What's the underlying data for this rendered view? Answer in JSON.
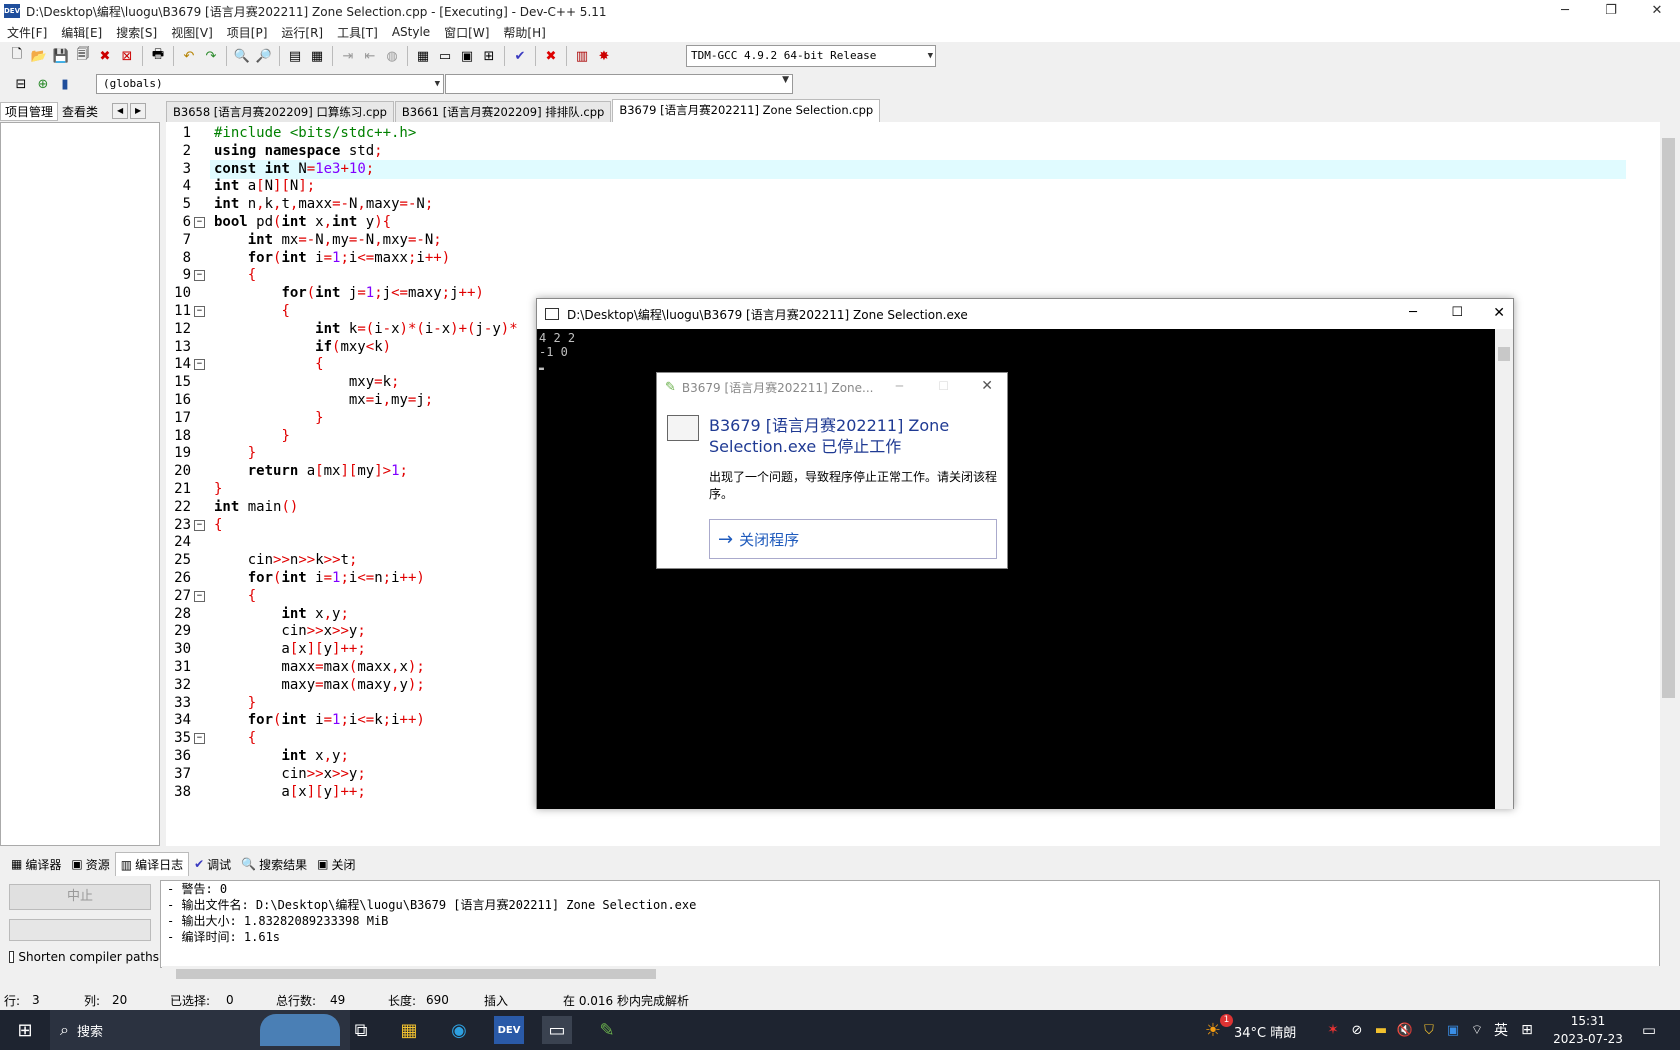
{
  "window": {
    "title": "D:\\Desktop\\编程\\luogu\\B3679 [语言月赛202211] Zone Selection.cpp - [Executing] - Dev-C++ 5.11",
    "app_icon_text": "DEV",
    "min": "─",
    "max": "❐",
    "close": "✕"
  },
  "menu": [
    "文件[F]",
    "编辑[E]",
    "搜索[S]",
    "视图[V]",
    "项目[P]",
    "运行[R]",
    "工具[T]",
    "AStyle",
    "窗口[W]",
    "帮助[H]"
  ],
  "compiler_select": "TDM-GCC 4.9.2 64-bit Release",
  "scope_select": "(globals)",
  "left_tabs": [
    "项目管理",
    "查看类"
  ],
  "left_tab_arrows": [
    "◀",
    "▶"
  ],
  "file_tabs": [
    "B3658 [语言月赛202209] 口算练习.cpp",
    "B3661 [语言月赛202209] 排排队.cpp",
    "B3679 [语言月赛202211] Zone Selection.cpp"
  ],
  "editor": {
    "lines": [
      {
        "n": "1",
        "code": "#include <bits/stdc++.h>"
      },
      {
        "n": "2",
        "code": "using namespace std;"
      },
      {
        "n": "3",
        "code": "const int N=1e3+10;"
      },
      {
        "n": "4",
        "code": "int a[N][N];"
      },
      {
        "n": "5",
        "code": "int n,k,t,maxx=-N,maxy=-N;"
      },
      {
        "n": "6",
        "code": "bool pd(int x,int y){",
        "fold": "−"
      },
      {
        "n": "7",
        "code": "    int mx=-N,my=-N,mxy=-N;"
      },
      {
        "n": "8",
        "code": "    for(int i=1;i<=maxx;i++)"
      },
      {
        "n": "9",
        "code": "    {",
        "fold": "−"
      },
      {
        "n": "10",
        "code": "        for(int j=1;j<=maxy;j++)"
      },
      {
        "n": "11",
        "code": "        {",
        "fold": "−"
      },
      {
        "n": "12",
        "code": "            int k=(i-x)*(i-x)+(j-y)*"
      },
      {
        "n": "13",
        "code": "            if(mxy<k)"
      },
      {
        "n": "14",
        "code": "            {",
        "fold": "−"
      },
      {
        "n": "15",
        "code": "                mxy=k;"
      },
      {
        "n": "16",
        "code": "                mx=i,my=j;"
      },
      {
        "n": "17",
        "code": "            }"
      },
      {
        "n": "18",
        "code": "        }"
      },
      {
        "n": "19",
        "code": "    }"
      },
      {
        "n": "20",
        "code": "    return a[mx][my]>1;"
      },
      {
        "n": "21",
        "code": "}"
      },
      {
        "n": "22",
        "code": "int main()"
      },
      {
        "n": "23",
        "code": "{",
        "fold": "−"
      },
      {
        "n": "24",
        "code": ""
      },
      {
        "n": "25",
        "code": "    cin>>n>>k>>t;"
      },
      {
        "n": "26",
        "code": "    for(int i=1;i<=n;i++)"
      },
      {
        "n": "27",
        "code": "    {",
        "fold": "−"
      },
      {
        "n": "28",
        "code": "        int x,y;"
      },
      {
        "n": "29",
        "code": "        cin>>x>>y;"
      },
      {
        "n": "30",
        "code": "        a[x][y]++;"
      },
      {
        "n": "31",
        "code": "        maxx=max(maxx,x);"
      },
      {
        "n": "32",
        "code": "        maxy=max(maxy,y);"
      },
      {
        "n": "33",
        "code": "    }"
      },
      {
        "n": "34",
        "code": "    for(int i=1;i<=k;i++)"
      },
      {
        "n": "35",
        "code": "    {",
        "fold": "−"
      },
      {
        "n": "36",
        "code": "        int x,y;"
      },
      {
        "n": "37",
        "code": "        cin>>x>>y;"
      },
      {
        "n": "38",
        "code": "        a[x][y]++;"
      }
    ]
  },
  "bottom_tabs": [
    "编译器",
    "资源",
    "编译日志",
    "调试",
    "搜索结果",
    "关闭"
  ],
  "abort_button": "中止",
  "shorten_paths": "Shorten compiler paths",
  "log": [
    "- 警告: 0",
    "- 输出文件名: D:\\Desktop\\编程\\luogu\\B3679 [语言月赛202211] Zone Selection.exe",
    "- 输出大小: 1.83282089233398 MiB",
    "- 编译时间: 1.61s"
  ],
  "status": {
    "row_label": "行:",
    "row": "3",
    "col_label": "列:",
    "col": "20",
    "sel_label": "已选择:",
    "sel": "0",
    "total_label": "总行数:",
    "total": "49",
    "len_label": "长度:",
    "len": "690",
    "mode": "插入",
    "parse": "在 0.016 秒内完成解析"
  },
  "console": {
    "title": "D:\\Desktop\\编程\\luogu\\B3679 [语言月赛202211] Zone Selection.exe",
    "lines": [
      "4 2 2",
      "-1 0",
      "▂"
    ],
    "min": "─",
    "max": "☐",
    "close": "✕"
  },
  "dialog": {
    "title": "B3679 [语言月赛202211] Zone...",
    "heading": "B3679 [语言月赛202211] Zone Selection.exe 已停止工作",
    "message": "出现了一个问题，导致程序停止正常工作。请关闭该程序。",
    "button": "关闭程序",
    "close": "✕",
    "min": "─",
    "max": "☐"
  },
  "taskbar": {
    "search": "搜索",
    "weather": "34°C 晴朗",
    "ime": "英",
    "time": "15:31",
    "date": "2023-07-23",
    "notification_badge": "1"
  },
  "colors": {
    "keyword": "#000000",
    "symbol": "#e00000",
    "preprocessor": "#008000",
    "number": "#8000ff",
    "current_line": "#e0fbff"
  }
}
